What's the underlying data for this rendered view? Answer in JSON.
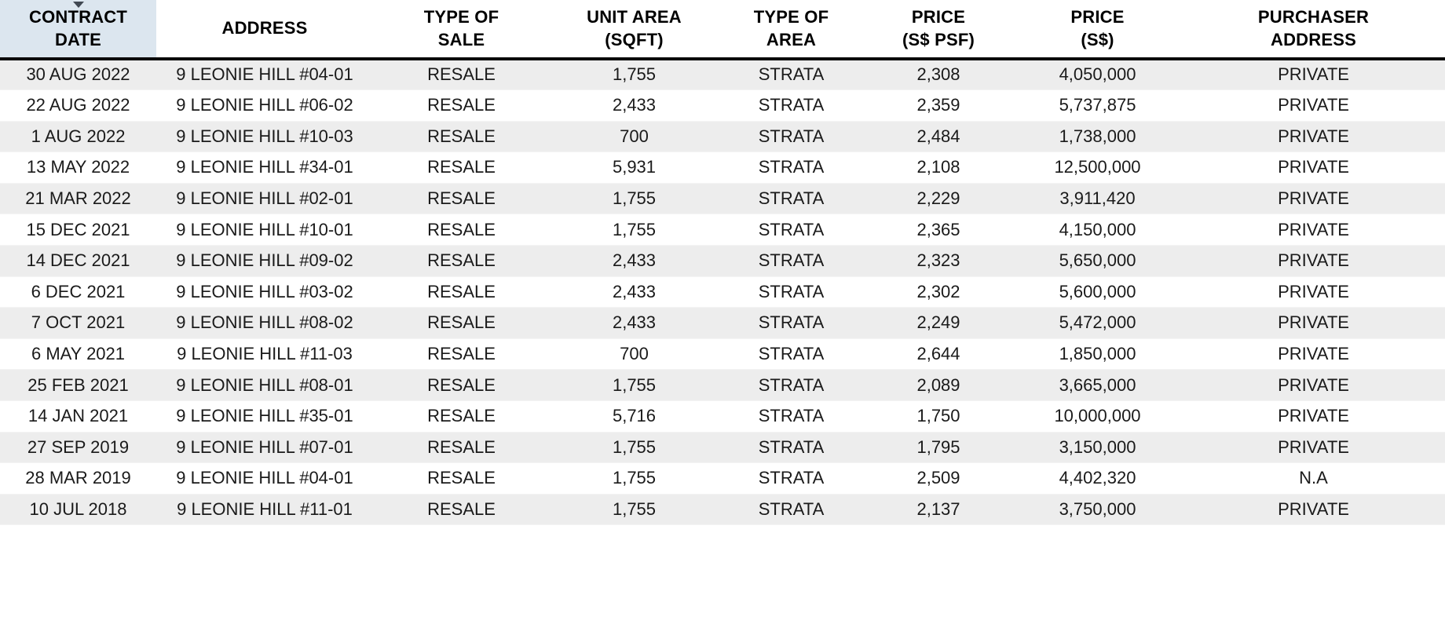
{
  "table": {
    "sort": {
      "column": "CONTRACT DATE",
      "direction": "descending",
      "indicator_icon": "caret-down-icon"
    },
    "colors": {
      "sorted_header_bg": "#dce6ef",
      "stripe_row_bg": "#ededed",
      "plain_row_bg": "#ffffff",
      "header_rule": "#0a0a0a",
      "text": "#1a1a1a"
    },
    "columns": [
      {
        "key": "contract_date",
        "line1": "CONTRACT",
        "line2": "DATE",
        "sorted": true
      },
      {
        "key": "address",
        "line1": "ADDRESS",
        "line2": "",
        "sorted": false
      },
      {
        "key": "type_of_sale",
        "line1": "TYPE OF",
        "line2": "SALE",
        "sorted": false
      },
      {
        "key": "unit_area",
        "line1": "UNIT AREA",
        "line2": "(SQFT)",
        "sorted": false
      },
      {
        "key": "type_of_area",
        "line1": "TYPE OF",
        "line2": "AREA",
        "sorted": false
      },
      {
        "key": "price_psf",
        "line1": "PRICE",
        "line2": "(S$ PSF)",
        "sorted": false
      },
      {
        "key": "price",
        "line1": "PRICE",
        "line2": "(S$)",
        "sorted": false
      },
      {
        "key": "purchaser_address",
        "line1": "PURCHASER",
        "line2": "ADDRESS",
        "sorted": false
      }
    ],
    "rows": [
      {
        "contract_date": "30 AUG 2022",
        "address": "9 LEONIE HILL #04-01",
        "type_of_sale": "RESALE",
        "unit_area": "1,755",
        "type_of_area": "STRATA",
        "price_psf": "2,308",
        "price": "4,050,000",
        "purchaser_address": "PRIVATE"
      },
      {
        "contract_date": "22 AUG 2022",
        "address": "9 LEONIE HILL #06-02",
        "type_of_sale": "RESALE",
        "unit_area": "2,433",
        "type_of_area": "STRATA",
        "price_psf": "2,359",
        "price": "5,737,875",
        "purchaser_address": "PRIVATE"
      },
      {
        "contract_date": "1 AUG 2022",
        "address": "9 LEONIE HILL #10-03",
        "type_of_sale": "RESALE",
        "unit_area": "700",
        "type_of_area": "STRATA",
        "price_psf": "2,484",
        "price": "1,738,000",
        "purchaser_address": "PRIVATE"
      },
      {
        "contract_date": "13 MAY 2022",
        "address": "9 LEONIE HILL #34-01",
        "type_of_sale": "RESALE",
        "unit_area": "5,931",
        "type_of_area": "STRATA",
        "price_psf": "2,108",
        "price": "12,500,000",
        "purchaser_address": "PRIVATE"
      },
      {
        "contract_date": "21 MAR 2022",
        "address": "9 LEONIE HILL #02-01",
        "type_of_sale": "RESALE",
        "unit_area": "1,755",
        "type_of_area": "STRATA",
        "price_psf": "2,229",
        "price": "3,911,420",
        "purchaser_address": "PRIVATE"
      },
      {
        "contract_date": "15 DEC 2021",
        "address": "9 LEONIE HILL #10-01",
        "type_of_sale": "RESALE",
        "unit_area": "1,755",
        "type_of_area": "STRATA",
        "price_psf": "2,365",
        "price": "4,150,000",
        "purchaser_address": "PRIVATE"
      },
      {
        "contract_date": "14 DEC 2021",
        "address": "9 LEONIE HILL #09-02",
        "type_of_sale": "RESALE",
        "unit_area": "2,433",
        "type_of_area": "STRATA",
        "price_psf": "2,323",
        "price": "5,650,000",
        "purchaser_address": "PRIVATE"
      },
      {
        "contract_date": "6 DEC 2021",
        "address": "9 LEONIE HILL #03-02",
        "type_of_sale": "RESALE",
        "unit_area": "2,433",
        "type_of_area": "STRATA",
        "price_psf": "2,302",
        "price": "5,600,000",
        "purchaser_address": "PRIVATE"
      },
      {
        "contract_date": "7 OCT 2021",
        "address": "9 LEONIE HILL #08-02",
        "type_of_sale": "RESALE",
        "unit_area": "2,433",
        "type_of_area": "STRATA",
        "price_psf": "2,249",
        "price": "5,472,000",
        "purchaser_address": "PRIVATE"
      },
      {
        "contract_date": "6 MAY 2021",
        "address": "9 LEONIE HILL #11-03",
        "type_of_sale": "RESALE",
        "unit_area": "700",
        "type_of_area": "STRATA",
        "price_psf": "2,644",
        "price": "1,850,000",
        "purchaser_address": "PRIVATE"
      },
      {
        "contract_date": "25 FEB 2021",
        "address": "9 LEONIE HILL #08-01",
        "type_of_sale": "RESALE",
        "unit_area": "1,755",
        "type_of_area": "STRATA",
        "price_psf": "2,089",
        "price": "3,665,000",
        "purchaser_address": "PRIVATE"
      },
      {
        "contract_date": "14 JAN 2021",
        "address": "9 LEONIE HILL #35-01",
        "type_of_sale": "RESALE",
        "unit_area": "5,716",
        "type_of_area": "STRATA",
        "price_psf": "1,750",
        "price": "10,000,000",
        "purchaser_address": "PRIVATE"
      },
      {
        "contract_date": "27 SEP 2019",
        "address": "9 LEONIE HILL #07-01",
        "type_of_sale": "RESALE",
        "unit_area": "1,755",
        "type_of_area": "STRATA",
        "price_psf": "1,795",
        "price": "3,150,000",
        "purchaser_address": "PRIVATE"
      },
      {
        "contract_date": "28 MAR 2019",
        "address": "9 LEONIE HILL #04-01",
        "type_of_sale": "RESALE",
        "unit_area": "1,755",
        "type_of_area": "STRATA",
        "price_psf": "2,509",
        "price": "4,402,320",
        "purchaser_address": "N.A"
      },
      {
        "contract_date": "10 JUL 2018",
        "address": "9 LEONIE HILL #11-01",
        "type_of_sale": "RESALE",
        "unit_area": "1,755",
        "type_of_area": "STRATA",
        "price_psf": "2,137",
        "price": "3,750,000",
        "purchaser_address": "PRIVATE"
      }
    ]
  }
}
